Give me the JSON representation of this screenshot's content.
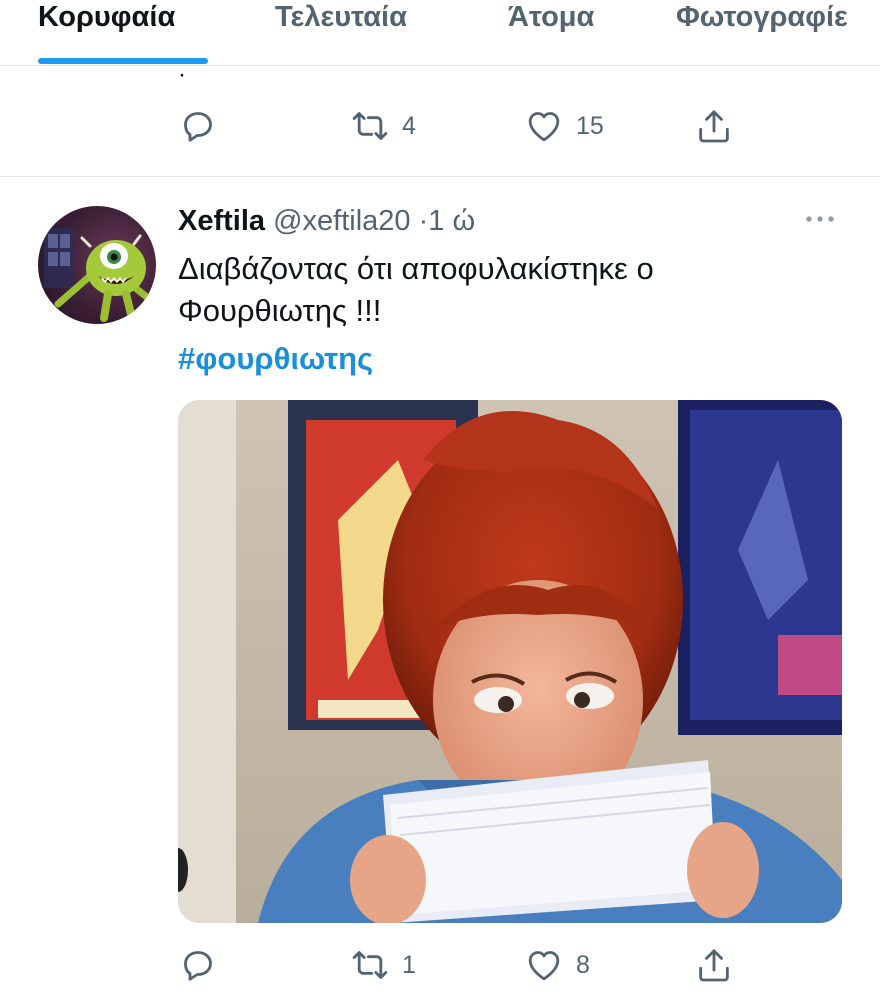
{
  "tabs": [
    {
      "label": "Κορυφαία",
      "active": true
    },
    {
      "label": "Τελευταία",
      "active": false
    },
    {
      "label": "Άτομα",
      "active": false
    },
    {
      "label": "Φωτογραφίε",
      "active": false
    }
  ],
  "previous_tweet": {
    "trailing_text": "·",
    "retweets": "4",
    "likes": "15"
  },
  "tweet": {
    "author_name": "Xeftila",
    "handle": "@xeftila20",
    "separator": "·",
    "time": "1 ώ",
    "text_line1": "Διαβάζοντας ότι αποφυλακίστηκε ο",
    "text_line2": "Φουρθιωτης  !!!",
    "hashtag": "#φουρθιωτης",
    "retweets": "1",
    "likes": "8"
  },
  "icons": {
    "reply": "reply-icon",
    "retweet": "retweet-icon",
    "like": "heart-icon",
    "share": "share-icon",
    "more": "more-icon"
  },
  "colors": {
    "accent": "#1d9bf0",
    "hashtag": "#1d8ed8",
    "secondary_text": "#536471",
    "primary_text": "#0f1419"
  }
}
